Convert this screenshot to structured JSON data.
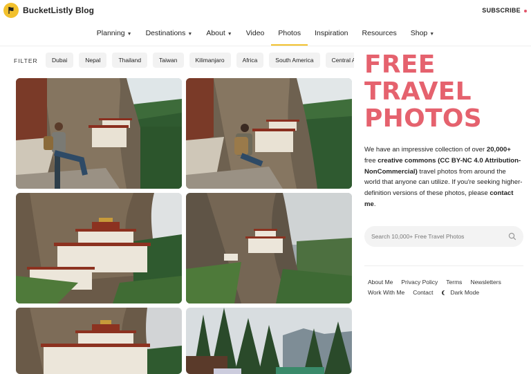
{
  "header": {
    "brand": "BucketListly Blog",
    "logo_icon": "flag-icon",
    "subscribe": "SUBSCRIBE",
    "accent_color": "#f2c12e",
    "brand_color": "#e5626e"
  },
  "nav": {
    "items": [
      {
        "label": "Planning",
        "dropdown": true
      },
      {
        "label": "Destinations",
        "dropdown": true
      },
      {
        "label": "About",
        "dropdown": true
      },
      {
        "label": "Video",
        "dropdown": false
      },
      {
        "label": "Photos",
        "dropdown": false,
        "active": true
      },
      {
        "label": "Inspiration",
        "dropdown": false
      },
      {
        "label": "Resources",
        "dropdown": false
      },
      {
        "label": "Shop",
        "dropdown": true
      }
    ]
  },
  "filter": {
    "label": "FILTER",
    "chips": [
      "Dubai",
      "Nepal",
      "Thailand",
      "Taiwan",
      "Kilimanjaro",
      "Africa",
      "South America",
      "Central America"
    ]
  },
  "photos": [
    {
      "name": "tigers-nest-man-sitting-facing"
    },
    {
      "name": "tigers-nest-man-sitting-back"
    },
    {
      "name": "tigers-nest-monastery-close"
    },
    {
      "name": "tigers-nest-monastery-far"
    },
    {
      "name": "tigers-nest-monastery-detail"
    },
    {
      "name": "forest-parking-lot"
    }
  ],
  "hero": {
    "line1": "FREE",
    "line2": "TRAVEL",
    "line3": "PHOTOS"
  },
  "description": {
    "p1": "We have an impressive collection of over ",
    "count": "20,000+",
    "p2": " free ",
    "license": "creative commons (CC BY-NC 4.0 Attribution-NonCommercial)",
    "p3": " travel photos from around the world that anyone can utilize. If you're seeking higher-definition versions of these photos, please ",
    "contact": "contact me",
    "p4": "."
  },
  "search": {
    "placeholder": "Search 10,000+ Free Travel Photos",
    "icon": "search-icon"
  },
  "footer": {
    "links": [
      "About Me",
      "Privacy Policy",
      "Terms",
      "Newsletters",
      "Work With Me",
      "Contact"
    ],
    "dark_mode": "Dark Mode"
  }
}
